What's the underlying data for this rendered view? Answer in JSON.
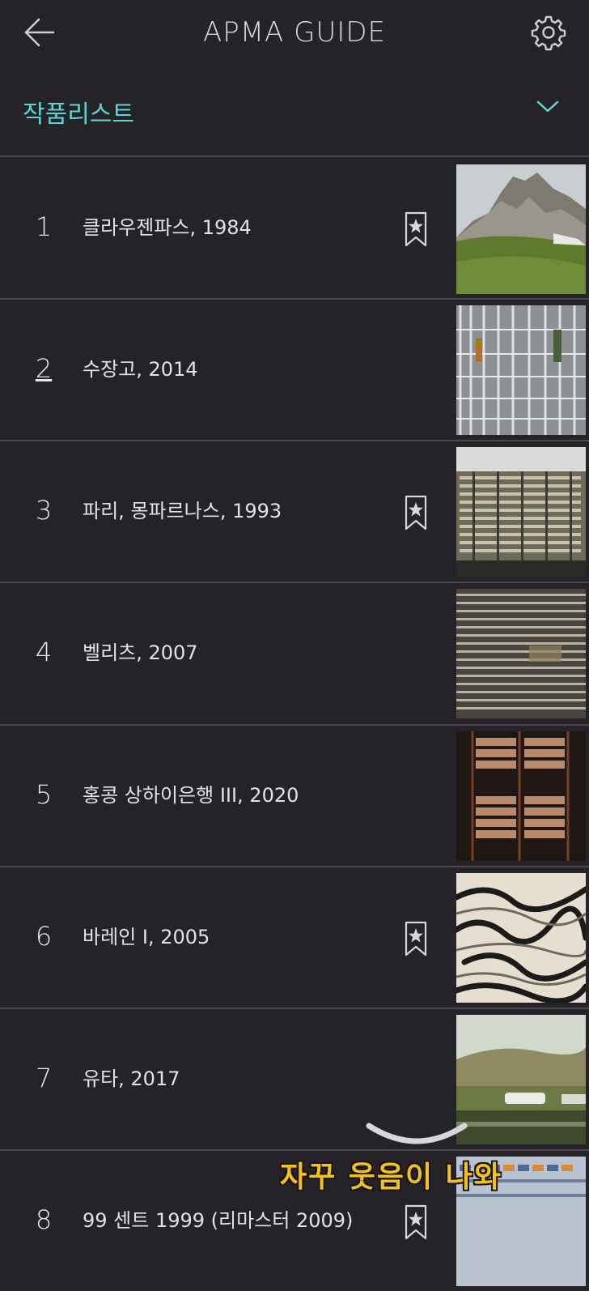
{
  "header": {
    "title": "APMA GUIDE",
    "back_icon": "back-arrow-icon",
    "settings_icon": "gear-icon"
  },
  "filter": {
    "label": "작품리스트",
    "icon": "chevron-down-icon",
    "accent_color": "#5ed6d0"
  },
  "artworks": [
    {
      "number": "1",
      "title": "클라우젠파스, 1984",
      "bookmarked": true
    },
    {
      "number": "2",
      "title": "수장고, 2014",
      "bookmarked": false
    },
    {
      "number": "3",
      "title": "파리, 몽파르나스, 1993",
      "bookmarked": true
    },
    {
      "number": "4",
      "title": "벨리츠, 2007",
      "bookmarked": false
    },
    {
      "number": "5",
      "title": "홍콩 상하이은행 III, 2020",
      "bookmarked": false
    },
    {
      "number": "6",
      "title": "바레인 I, 2005",
      "bookmarked": true
    },
    {
      "number": "7",
      "title": "유타, 2017",
      "bookmarked": false
    },
    {
      "number": "8",
      "title": "99 센트 1999 (리마스터 2009)",
      "bookmarked": true
    }
  ],
  "overlay": {
    "watermark_text": "자꾸 웃음이 나와"
  },
  "colors": {
    "background": "#262328",
    "divider": "#4a474c",
    "accent": "#5ed6d0"
  }
}
